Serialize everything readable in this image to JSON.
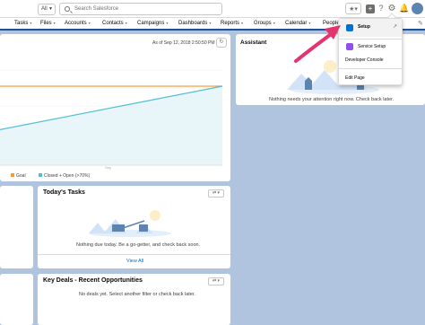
{
  "header": {
    "scope_label": "All",
    "search_placeholder": "Search Salesforce",
    "utility": {
      "favorites": "★▾",
      "plus": "+",
      "help": "?",
      "gear": "⚙",
      "bell": "🔔"
    }
  },
  "nav": {
    "items": [
      {
        "label": "Tasks"
      },
      {
        "label": "Files"
      },
      {
        "label": "Accounts"
      },
      {
        "label": "Contacts"
      },
      {
        "label": "Campaigns"
      },
      {
        "label": "Dashboards"
      },
      {
        "label": "Reports"
      },
      {
        "label": "Groups"
      },
      {
        "label": "Calendar"
      },
      {
        "label": "People"
      }
    ],
    "dropdown_glyph": "▾",
    "edit_glyph": "✎"
  },
  "chart_card": {
    "as_of": "As of Sep 12, 2018 2:50:50 PM",
    "refresh_glyph": "↻",
    "x_tick": "Sep",
    "legend": [
      {
        "label": "Goal",
        "color": "#f59c37"
      },
      {
        "label": "Closed + Open (>70%)",
        "color": "#54bfd3"
      }
    ]
  },
  "chart_data": {
    "type": "line",
    "title": "",
    "x": [
      "",
      "Sep"
    ],
    "series": [
      {
        "name": "Goal",
        "values": [
          1,
          1
        ],
        "color": "#f59c37"
      },
      {
        "name": "Closed + Open (>70%)",
        "values": [
          0.45,
          1
        ],
        "color": "#54bfd3"
      }
    ],
    "grid": true,
    "legend_position": "bottom"
  },
  "assistant": {
    "title": "Assistant",
    "message": "Nothing needs your attention right now. Check back later."
  },
  "tasks": {
    "title": "Today's Tasks",
    "message": "Nothing due today. Be a go-getter, and check back soon.",
    "view_all": "View All",
    "button_glyph": "⇄ ▾"
  },
  "deals": {
    "title": "Key Deals - Recent Opportunities",
    "message": "No deals yet. Select another filter or check back later.",
    "button_glyph": "⇄ ▾"
  },
  "setup_menu": {
    "items": [
      {
        "label": "Setup",
        "color": "#0070d2"
      },
      {
        "label": "Service Setup",
        "color": "#9050e9"
      },
      {
        "label": "Developer Console",
        "color": ""
      },
      {
        "label": "Edit Page",
        "color": ""
      }
    ],
    "open_glyph": "↗"
  },
  "accent_colors": {
    "nav_bar": "#1b5297",
    "link": "#006dcc",
    "arrow": "#e5336f"
  }
}
